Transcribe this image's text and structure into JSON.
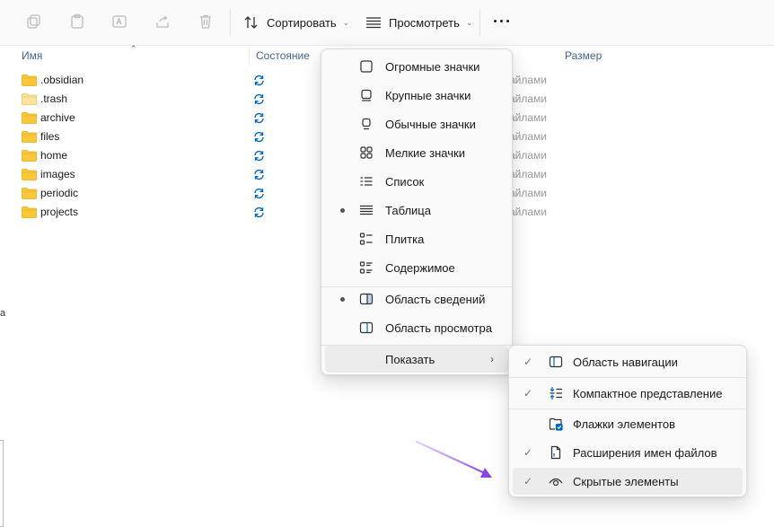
{
  "toolbar": {
    "sort_label": "Сортировать",
    "view_label": "Просмотреть",
    "more_icon": "more-horizontal-icon"
  },
  "columns": {
    "name": "Имя",
    "status": "Состояние",
    "size": "Размер"
  },
  "files": [
    {
      "name": ".obsidian",
      "status_text": "айлами"
    },
    {
      "name": ".trash",
      "status_text": "айлами"
    },
    {
      "name": "archive",
      "status_text": "айлами"
    },
    {
      "name": "files",
      "status_text": "айлами"
    },
    {
      "name": "home",
      "status_text": "айлами"
    },
    {
      "name": "images",
      "status_text": "айлами"
    },
    {
      "name": "periodic",
      "status_text": "айлами"
    },
    {
      "name": "projects",
      "status_text": "айлами"
    }
  ],
  "view_menu": {
    "items": [
      {
        "label": "Огромные значки",
        "icon": "extra-large-icons-icon",
        "selected": false
      },
      {
        "label": "Крупные значки",
        "icon": "large-icons-icon",
        "selected": false
      },
      {
        "label": "Обычные значки",
        "icon": "medium-icons-icon",
        "selected": false
      },
      {
        "label": "Мелкие значки",
        "icon": "small-icons-icon",
        "selected": false
      },
      {
        "label": "Список",
        "icon": "list-icon",
        "selected": false
      },
      {
        "label": "Таблица",
        "icon": "details-icon",
        "selected": true
      },
      {
        "label": "Плитка",
        "icon": "tiles-icon",
        "selected": false
      },
      {
        "label": "Содержимое",
        "icon": "content-icon",
        "selected": false
      },
      {
        "label": "Область сведений",
        "icon": "details-pane-icon",
        "selected": true
      },
      {
        "label": "Область просмотра",
        "icon": "preview-pane-icon",
        "selected": false
      },
      {
        "label": "Показать",
        "icon": "",
        "selected": false
      }
    ]
  },
  "show_menu": {
    "items": [
      {
        "label": "Область навигации",
        "icon": "navigation-pane-icon",
        "checked": true
      },
      {
        "label": "Компактное представление",
        "icon": "compact-view-icon",
        "checked": true
      },
      {
        "label": "Флажки элементов",
        "icon": "item-checkboxes-icon",
        "checked": false
      },
      {
        "label": "Расширения имен файлов",
        "icon": "file-extensions-icon",
        "checked": true
      },
      {
        "label": "Скрытые элементы",
        "icon": "hidden-items-icon",
        "checked": true
      }
    ]
  },
  "colors": {
    "accent": "#0067c0",
    "folder": "#f8c83a",
    "pointer": "#8b44e6"
  }
}
